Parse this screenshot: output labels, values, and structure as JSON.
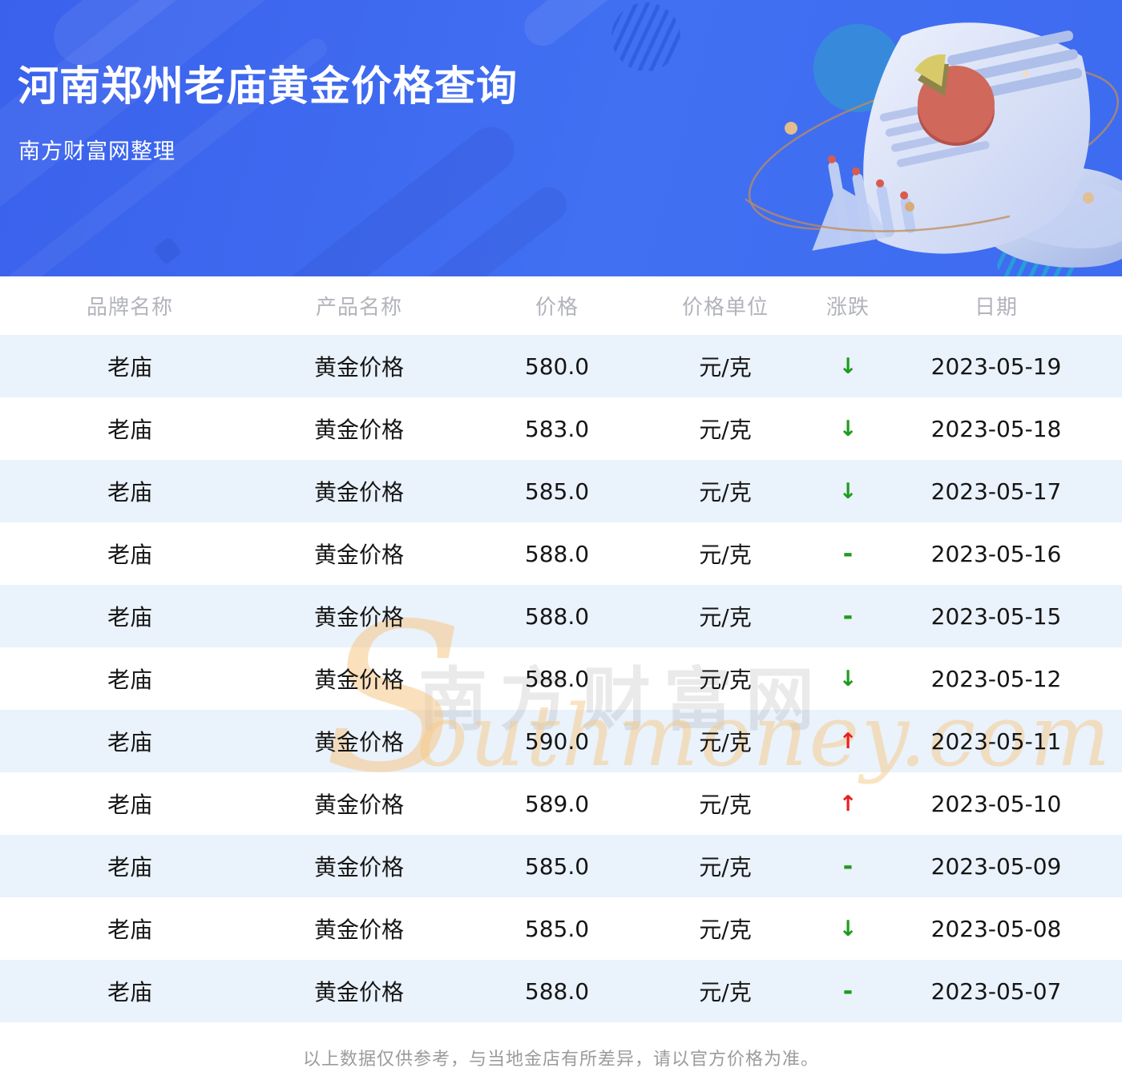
{
  "banner": {
    "title": "河南郑州老庙黄金价格查询",
    "subtitle": "南方财富网整理"
  },
  "table": {
    "headers": [
      "品牌名称",
      "产品名称",
      "价格",
      "价格单位",
      "涨跌",
      "日期"
    ],
    "rows": [
      {
        "brand": "老庙",
        "product": "黄金价格",
        "price": "580.0",
        "unit": "元/克",
        "change": "down",
        "date": "2023-05-19"
      },
      {
        "brand": "老庙",
        "product": "黄金价格",
        "price": "583.0",
        "unit": "元/克",
        "change": "down",
        "date": "2023-05-18"
      },
      {
        "brand": "老庙",
        "product": "黄金价格",
        "price": "585.0",
        "unit": "元/克",
        "change": "down",
        "date": "2023-05-17"
      },
      {
        "brand": "老庙",
        "product": "黄金价格",
        "price": "588.0",
        "unit": "元/克",
        "change": "flat",
        "date": "2023-05-16"
      },
      {
        "brand": "老庙",
        "product": "黄金价格",
        "price": "588.0",
        "unit": "元/克",
        "change": "flat",
        "date": "2023-05-15"
      },
      {
        "brand": "老庙",
        "product": "黄金价格",
        "price": "588.0",
        "unit": "元/克",
        "change": "down",
        "date": "2023-05-12"
      },
      {
        "brand": "老庙",
        "product": "黄金价格",
        "price": "590.0",
        "unit": "元/克",
        "change": "up",
        "date": "2023-05-11"
      },
      {
        "brand": "老庙",
        "product": "黄金价格",
        "price": "589.0",
        "unit": "元/克",
        "change": "up",
        "date": "2023-05-10"
      },
      {
        "brand": "老庙",
        "product": "黄金价格",
        "price": "585.0",
        "unit": "元/克",
        "change": "flat",
        "date": "2023-05-09"
      },
      {
        "brand": "老庙",
        "product": "黄金价格",
        "price": "585.0",
        "unit": "元/克",
        "change": "down",
        "date": "2023-05-08"
      },
      {
        "brand": "老庙",
        "product": "黄金价格",
        "price": "588.0",
        "unit": "元/克",
        "change": "flat",
        "date": "2023-05-07"
      }
    ]
  },
  "change_symbols": {
    "down": "↓",
    "up": "↑",
    "flat": "-"
  },
  "watermark": {
    "cjk": "南方财富网",
    "initial": "S",
    "script": "outhmoney.com"
  },
  "footer": {
    "disclaimer": "以上数据仅供参考，与当地金店有所差异，请以官方价格为准。"
  },
  "colors": {
    "accent-blue": "#3f6af0",
    "row-alt": "#eaf2fb",
    "up-red": "#e82020",
    "down-green": "#1e9b1e",
    "header-gray": "#b2b4bb",
    "footer-gray": "#9b9b9b"
  }
}
